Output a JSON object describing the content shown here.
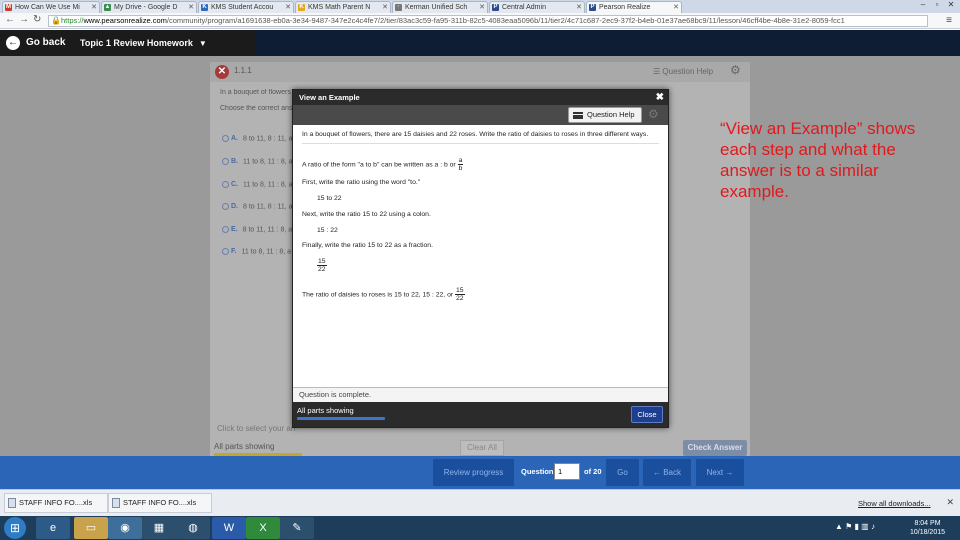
{
  "browser": {
    "tabs": [
      {
        "label": "How Can We Use Mi",
        "fav": "M",
        "color": "#c63d2b"
      },
      {
        "label": "My Drive - Google D",
        "fav": "▲",
        "color": "#3b8d4f"
      },
      {
        "label": "KMS Student Accou",
        "fav": "K",
        "color": "#2e6bbd"
      },
      {
        "label": "KMS Math Parent N",
        "fav": "K",
        "color": "#e2a820"
      },
      {
        "label": "Kerman Unified Sch",
        "fav": "·",
        "color": "#777777"
      },
      {
        "label": "Central Admin",
        "fav": "P",
        "color": "#2a4c8a"
      },
      {
        "label": "Pearson Realize",
        "fav": "P",
        "color": "#2a4c8a"
      }
    ],
    "url_scheme": "https://",
    "url_host": "www.pearsonrealize.com",
    "url_path": "/community/program/a1691638-eb0a-3e34-9487-347e2c4c4fe7/2/tier/83ac3c59-fa95-311b-82c5-4083eaa5096b/11/tier2/4c71c687-2ec9-37f2-b4eb-01e37ae68bc9/11/lesson/46cff4be-4b8e-31e2-8059-fcc1"
  },
  "header": {
    "back_label": "Go back",
    "title": "Topic 1 Review Homework"
  },
  "question_panel": {
    "number": "1.1.1",
    "help_label": "Question Help",
    "stem": "In a bouquet of flowers",
    "instruction": "Choose the correct ans",
    "choices": [
      {
        "letter": "A.",
        "text": "8 to 11, 8 : 11, a"
      },
      {
        "letter": "B.",
        "text": "11 to 8, 11 : 8, a"
      },
      {
        "letter": "C.",
        "text": "11 to 8, 11 : 8, a"
      },
      {
        "letter": "D.",
        "text": "8 to 11, 8 : 11, a"
      },
      {
        "letter": "E.",
        "text": "8 to 11, 11 : 8, a"
      },
      {
        "letter": "F.",
        "text": "11 to 8, 11 : 8, a"
      }
    ],
    "answer_hint": "Click to select your an",
    "parts_showing": "All parts showing",
    "clear_label": "Clear All",
    "check_label": "Check Answer"
  },
  "modal": {
    "title": "View an Example",
    "help_label": "Question Help",
    "problem": "In a bouquet of flowers, there are 15 daisies and 22 roses. Write the ratio of daisies to roses in three different ways.",
    "form_text": "A ratio of the form \"a to b\" can be written as a : b or",
    "form_num": "a",
    "form_den": "b",
    "step1": "First, write the ratio using the word \"to.\"",
    "step1_ans": "15 to 22",
    "step2": "Next, write the ratio 15 to 22 using a colon.",
    "step2_ans": "15 : 22",
    "step3": "Finally, write the ratio 15 to 22 as a fraction.",
    "step3_num": "15",
    "step3_den": "22",
    "conclusion": "The ratio of daisies to roses is 15 to 22, 15 : 22, or",
    "conclusion_num": "15",
    "conclusion_den": "22",
    "status": "Question is complete.",
    "parts_showing": "All parts showing",
    "close_label": "Close"
  },
  "annotation": "“View an Example” shows each step and what the answer is to a similar example.",
  "navbar": {
    "review_label": "Review progress",
    "question_label": "Question",
    "question_value": "1",
    "of_label": "of 20",
    "go_label": "Go",
    "back_label": "← Back",
    "next_label": "Next →"
  },
  "downloads": {
    "items": [
      "STAFF INFO FO....xls",
      "STAFF INFO FO....xls"
    ],
    "show_all": "Show all downloads..."
  },
  "taskbar": {
    "time": "8:04 PM",
    "date": "10/18/2015"
  },
  "colors": {
    "accent_blue": "#2a65b8",
    "annotation_red": "#e0191d",
    "header_dark": "#1b1b1b"
  }
}
